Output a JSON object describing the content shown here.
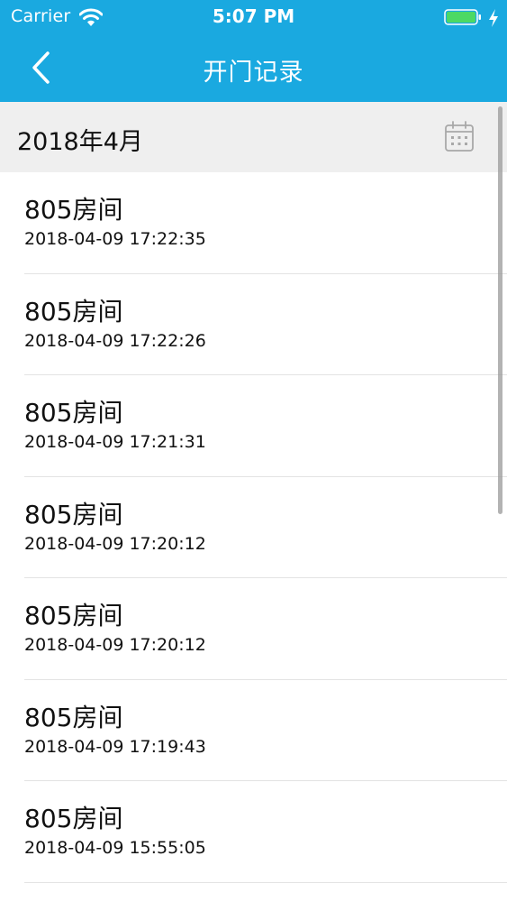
{
  "status_bar": {
    "carrier": "Carrier",
    "time": "5:07 PM",
    "wifi_icon": "wifi-icon",
    "battery_icon": "battery-icon",
    "charging_icon": "charging-bolt-icon",
    "battery_color": "#4cd964"
  },
  "nav": {
    "back_icon": "chevron-left-icon",
    "title": "开门记录",
    "background": "#1aa9e0"
  },
  "month_header": {
    "label": "2018年4月",
    "calendar_icon": "calendar-icon"
  },
  "records": [
    {
      "room": "805房间",
      "timestamp": "2018-04-09 17:22:35"
    },
    {
      "room": "805房间",
      "timestamp": "2018-04-09 17:22:26"
    },
    {
      "room": "805房间",
      "timestamp": "2018-04-09 17:21:31"
    },
    {
      "room": "805房间",
      "timestamp": "2018-04-09 17:20:12"
    },
    {
      "room": "805房间",
      "timestamp": "2018-04-09 17:20:12"
    },
    {
      "room": "805房间",
      "timestamp": "2018-04-09 17:19:43"
    },
    {
      "room": "805房间",
      "timestamp": "2018-04-09 15:55:05"
    }
  ]
}
